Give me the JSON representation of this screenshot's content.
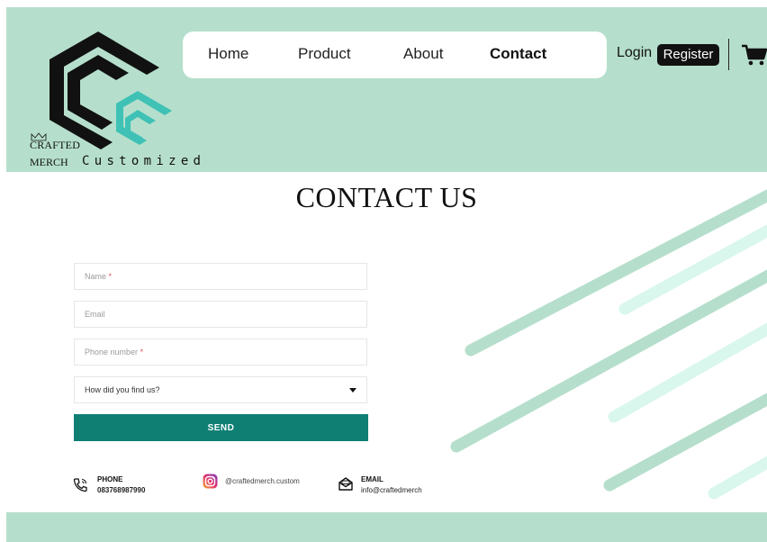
{
  "brand": {
    "line1": "CRAFTED",
    "line2": "MERCH",
    "tagline": "Customized"
  },
  "nav": {
    "items": [
      {
        "label": "Home"
      },
      {
        "label": "Product"
      },
      {
        "label": "About"
      },
      {
        "label": "Contact",
        "active": true
      }
    ]
  },
  "account": {
    "login_label": "Login",
    "register_label": "Register"
  },
  "page": {
    "title": "CONTACT US"
  },
  "form": {
    "name_placeholder": "Name",
    "name_required_mark": "*",
    "email_placeholder": "Email",
    "phone_placeholder": "Phone number",
    "phone_required_mark": "*",
    "source_selected": "How did you find us?",
    "send_label": "SEND"
  },
  "contact_info": {
    "phone_label": "PHONE",
    "phone_value": "083768987990",
    "instagram_handle": "@craftedmerch.custom",
    "email_label": "EMAIL",
    "email_value": "info@craftedmerch"
  },
  "colors": {
    "mint": "#b5dfcc",
    "stripe_dark": "#b5dfcc",
    "stripe_light": "#d9f7ec",
    "teal_accent": "#0f7f74",
    "logo_teal": "#3fc1b6"
  },
  "icons": [
    "logo-mark",
    "cart-icon",
    "phone-icon",
    "instagram-icon",
    "email-icon",
    "caret-down-icon"
  ]
}
